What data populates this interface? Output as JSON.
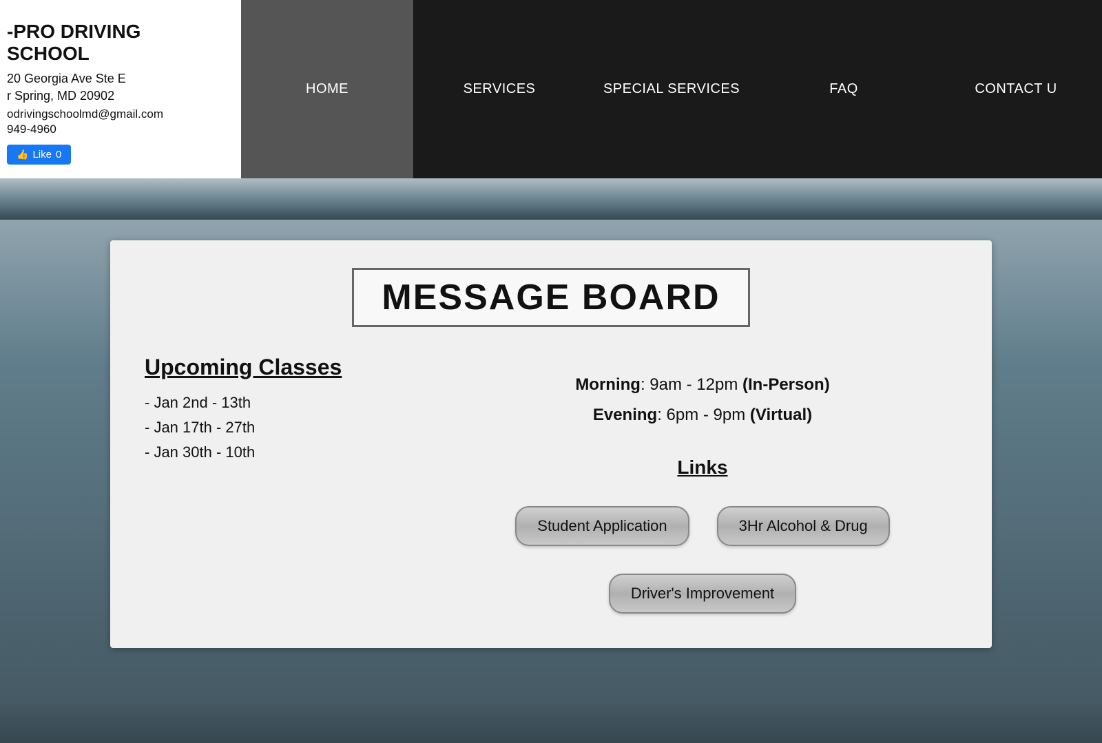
{
  "header": {
    "logo_title": "-PRO DRIVING SCHOOL",
    "address_line1": "20 Georgia Ave Ste E",
    "address_line2": "r Spring, MD 20902",
    "email": "odrivingschoolmd@gmail.com",
    "phone": "949-4960",
    "like_label": "Like",
    "like_count": "0"
  },
  "nav": {
    "items": [
      {
        "id": "home",
        "label": "HOME",
        "active": true
      },
      {
        "id": "services",
        "label": "SERVICES",
        "active": false
      },
      {
        "id": "special-services",
        "label": "SPECIAL SERVICES",
        "active": false
      },
      {
        "id": "faq",
        "label": "FAQ",
        "active": false
      },
      {
        "id": "contact",
        "label": "CONTACT U",
        "active": false
      }
    ]
  },
  "message_board": {
    "title": "MESSAGE BOARD",
    "upcoming_classes": {
      "heading": "Upcoming Classes",
      "classes": [
        "- Jan 2nd - 13th",
        "- Jan 17th - 27th",
        "- Jan 30th - 10th"
      ]
    },
    "schedule": {
      "morning_label": "Morning",
      "morning_time": ": 9am - 12pm",
      "morning_mode": "(In-Person)",
      "evening_label": "Evening",
      "evening_time": ": 6pm - 9pm",
      "evening_mode": "(Virtual)"
    },
    "links": {
      "heading": "Links",
      "buttons": [
        {
          "id": "student-application",
          "label": "Student Application"
        },
        {
          "id": "alcohol-drug",
          "label": "3Hr Alcohol & Drug"
        },
        {
          "id": "drivers-improvement",
          "label": "Driver's Improvement"
        }
      ]
    }
  }
}
